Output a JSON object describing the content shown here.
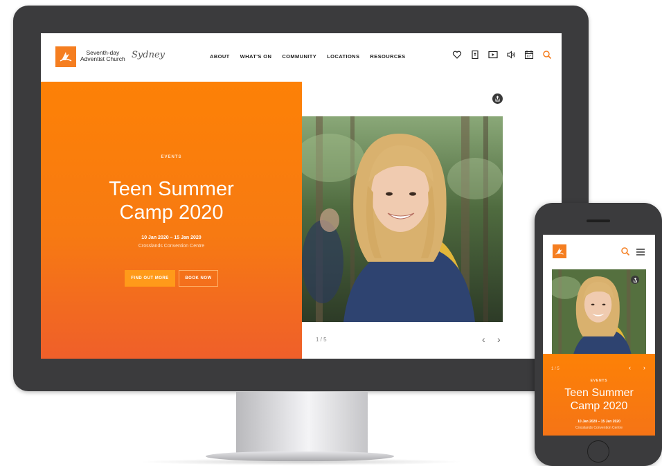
{
  "brand": {
    "church_line1": "Seventh-day",
    "church_line2": "Adventist Church",
    "city": "Sydney",
    "logo_icon": "adventist-flame-icon",
    "accent": "#f57e20"
  },
  "nav": {
    "items": [
      {
        "label": "ABOUT"
      },
      {
        "label": "WHAT'S ON"
      },
      {
        "label": "COMMUNITY"
      },
      {
        "label": "LOCATIONS"
      },
      {
        "label": "RESOURCES"
      }
    ]
  },
  "header_icons": [
    "heart-icon",
    "bible-icon",
    "video-play-icon",
    "audio-speaker-icon",
    "calendar-icon",
    "search-icon"
  ],
  "hero": {
    "category": "EVENTS",
    "title_line1": "Teen Summer",
    "title_line2": "Camp 2020",
    "date": "10 Jan 2020 – 15 Jan 2020",
    "venue": "Crosslands Convention Centre",
    "primary_button": "FIND OUT MORE",
    "secondary_button": "BOOK NOW",
    "gradient_top": "#fd8106",
    "gradient_bottom": "#ef5f2a"
  },
  "slider": {
    "counter": "1 / 5",
    "prev_icon": "chevron-left-icon",
    "next_icon": "chevron-right-icon",
    "share_icon": "share-icon"
  },
  "mobile": {
    "counter": "1 / 5",
    "category": "EVENTS",
    "title_line1": "Teen Summer",
    "title_line2": "Camp 2020",
    "date": "10 Jan 2020 – 15 Jan 2020",
    "venue": "Crosslands Convention Centre",
    "menu_icon": "hamburger-menu-icon",
    "search_icon": "search-icon"
  }
}
